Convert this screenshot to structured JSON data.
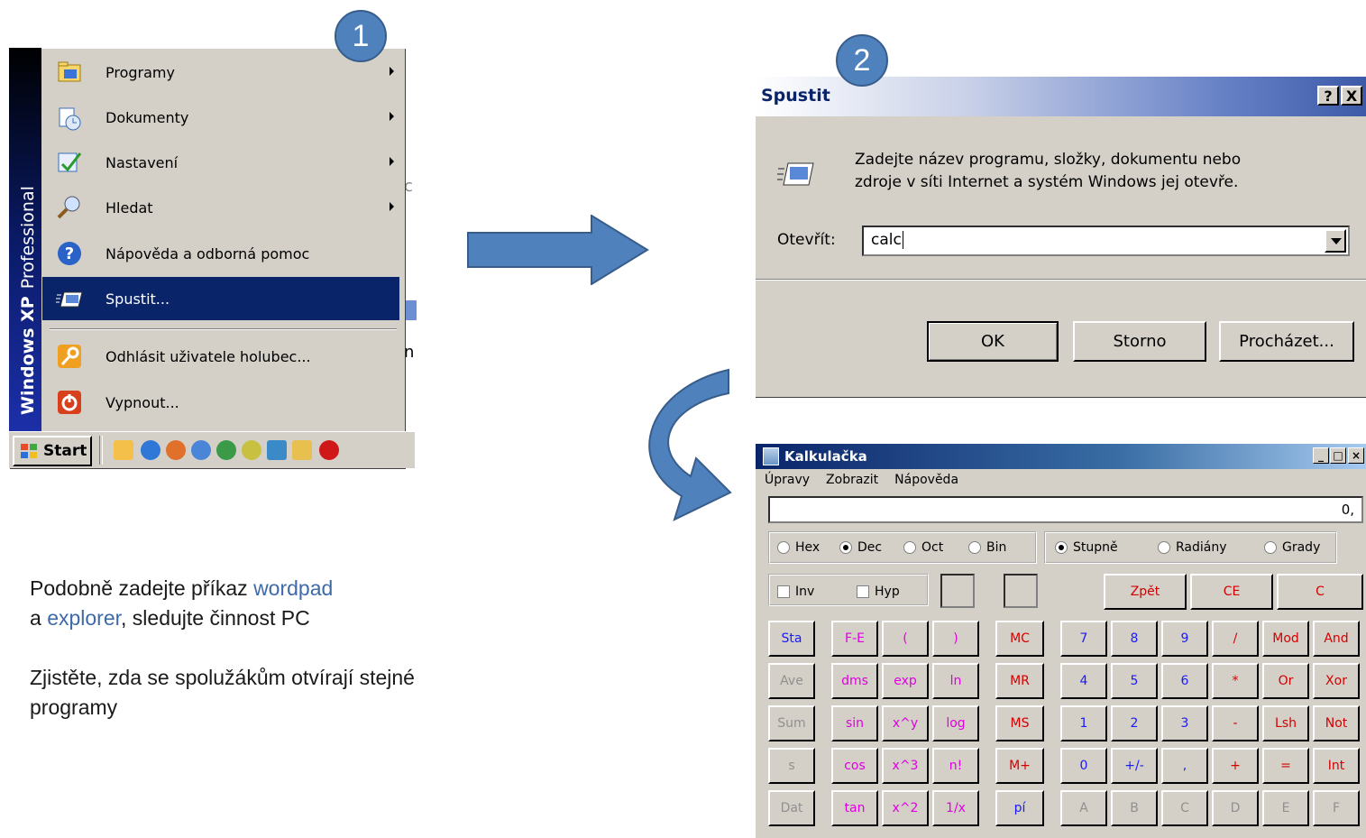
{
  "badges": {
    "step1": "1",
    "step2": "2"
  },
  "start_menu": {
    "banner": "Windows XP Professional",
    "items": [
      {
        "label": "Programy",
        "submenu": true,
        "icon": "programs-icon"
      },
      {
        "label": "Dokumenty",
        "submenu": true,
        "icon": "documents-icon"
      },
      {
        "label": "Nastavení",
        "submenu": true,
        "icon": "settings-icon"
      },
      {
        "label": "Hledat",
        "submenu": true,
        "icon": "search-icon"
      },
      {
        "label": "Nápověda a odborná pomoc",
        "submenu": false,
        "icon": "help-icon"
      },
      {
        "label": "Spustit...",
        "submenu": false,
        "icon": "run-icon",
        "selected": true
      },
      {
        "label": "Odhlásit uživatele holubec...",
        "submenu": false,
        "icon": "logoff-icon"
      },
      {
        "label": "Vypnout...",
        "submenu": false,
        "icon": "shutdown-icon"
      }
    ],
    "start_button": "Start"
  },
  "run_dialog": {
    "title": "Spustit",
    "help_btn": "?",
    "close_btn": "X",
    "message_line1": "Zadejte název programu, složky, dokumentu nebo",
    "message_line2": "zdroje v síti Internet a systém Windows jej otevře.",
    "open_label": "Otevřít:",
    "input_value": "calc",
    "ok": "OK",
    "cancel": "Storno",
    "browse": "Procházet..."
  },
  "calculator": {
    "title": "Kalkulačka",
    "menu": [
      "Úpravy",
      "Zobrazit",
      "Nápověda"
    ],
    "display": "0,",
    "bases": [
      "Hex",
      "Dec",
      "Oct",
      "Bin"
    ],
    "selected_base": "Dec",
    "angles": [
      "Stupně",
      "Radiány",
      "Grady"
    ],
    "selected_angle": "Stupně",
    "inv": "Inv",
    "hyp": "Hyp",
    "edit_keys": [
      "Zpět",
      "CE",
      "C"
    ],
    "rows": [
      [
        "Sta",
        "F-E",
        "(",
        ")",
        "MC",
        "7",
        "8",
        "9",
        "/",
        "Mod",
        "And"
      ],
      [
        "Ave",
        "dms",
        "exp",
        "ln",
        "MR",
        "4",
        "5",
        "6",
        "*",
        "Or",
        "Xor"
      ],
      [
        "Sum",
        "sin",
        "x^y",
        "log",
        "MS",
        "1",
        "2",
        "3",
        "-",
        "Lsh",
        "Not"
      ],
      [
        "s",
        "cos",
        "x^3",
        "n!",
        "M+",
        "0",
        "+/-",
        ",",
        "+",
        "=",
        "Int"
      ],
      [
        "Dat",
        "tan",
        "x^2",
        "1/x",
        "pí",
        "A",
        "B",
        "C",
        "D",
        "E",
        "F"
      ]
    ],
    "key_colors": {
      "red": "#d40000",
      "blue": "#1a1aff",
      "magenta": "#e000e0",
      "gray": "#909090"
    }
  },
  "instructions": {
    "p1_a": "Podobně zadejte příkaz ",
    "p1_w1": "wordpad",
    "p1_b": "a ",
    "p1_w2": "explorer",
    "p1_c": ", sledujte činnost PC",
    "p2": "Zjistěte, zda se spolužákům otvírají stejné programy"
  }
}
